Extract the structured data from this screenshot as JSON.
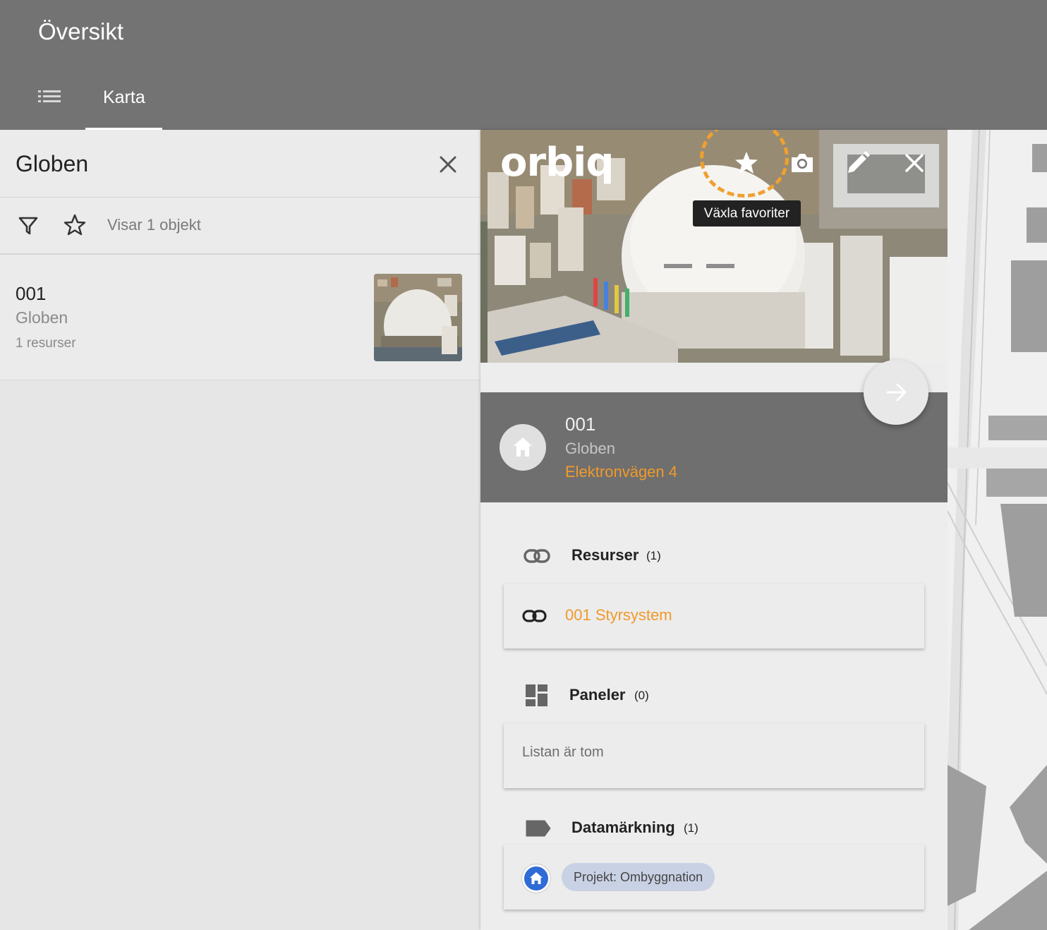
{
  "app": {
    "title": "Översikt"
  },
  "tabs": {
    "list_icon": "list-icon",
    "karta": "Karta"
  },
  "left_panel": {
    "title": "Globen",
    "count_label": "Visar 1 objekt",
    "items": [
      {
        "code": "001",
        "name": "Globen",
        "resources": "1 resurser"
      }
    ]
  },
  "detail": {
    "logo": "orbiq",
    "tooltip": "Växla favoriter",
    "code": "001",
    "name": "Globen",
    "address": "Elektronvägen 4",
    "sections": {
      "resources": {
        "title": "Resurser",
        "count": "(1)",
        "items": [
          "001 Styrsystem"
        ]
      },
      "panels": {
        "title": "Paneler",
        "count": "(0)",
        "empty": "Listan är tom"
      },
      "tags": {
        "title": "Datamärkning",
        "count": "(1)",
        "chips": [
          "Projekt: Ombyggnation"
        ]
      }
    }
  },
  "colors": {
    "appbar": "#737373",
    "accent": "#f09a2a",
    "info_bar": "#6f6f6f",
    "chip_bg": "#c9d1e5",
    "chip_avatar": "#2f6bd6"
  },
  "icons": [
    "list-icon",
    "close-icon",
    "filter-icon",
    "star-outline-icon",
    "star-icon",
    "camera-icon",
    "edit-icon",
    "arrow-right-icon",
    "home-icon",
    "link-icon",
    "dashboard-icon",
    "label-icon"
  ]
}
